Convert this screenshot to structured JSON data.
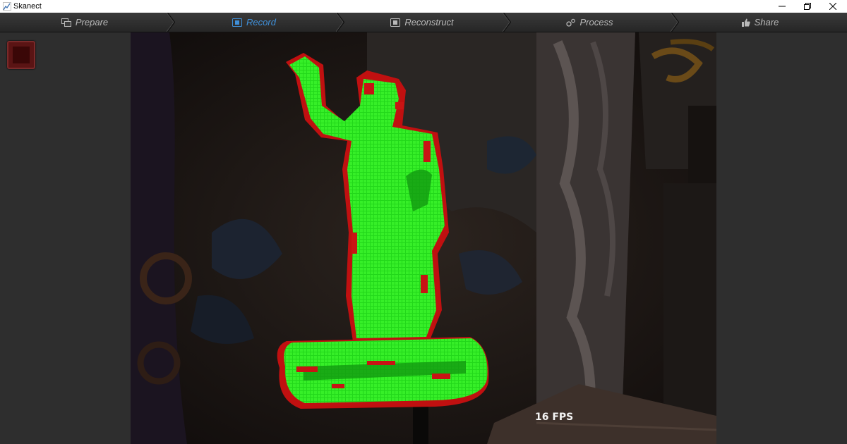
{
  "window": {
    "title": "Skanect"
  },
  "nav": {
    "tabs": [
      {
        "label": "Prepare",
        "icon": "prepare-icon",
        "active": false
      },
      {
        "label": "Record",
        "icon": "record-icon",
        "active": true
      },
      {
        "label": "Reconstruct",
        "icon": "reconstruct-icon",
        "active": false
      },
      {
        "label": "Process",
        "icon": "process-icon",
        "active": false
      },
      {
        "label": "Share",
        "icon": "thumbs-up-icon",
        "active": false
      }
    ]
  },
  "viewport": {
    "fps_label": "16 FPS"
  },
  "colors": {
    "accent": "#3f8fd8",
    "scan_green": "#22e01a",
    "scan_red": "#c81414",
    "stop_button": "#5a1414"
  }
}
